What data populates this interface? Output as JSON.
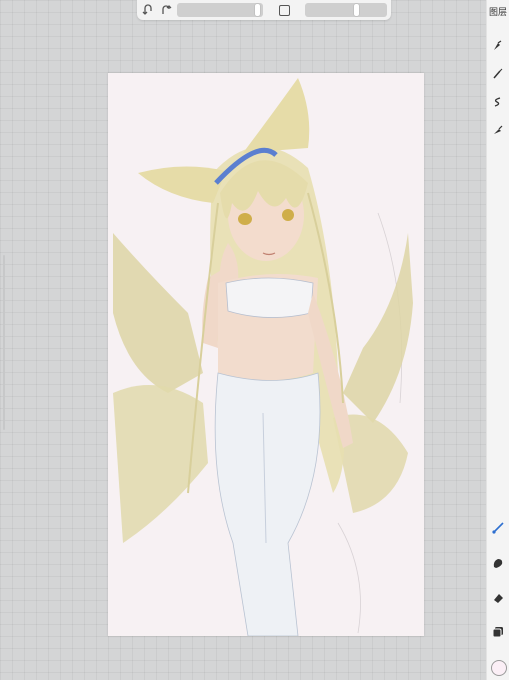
{
  "toolbar": {
    "undo_icon": "undo-arrow-icon",
    "redo_icon": "redo-arrow-icon",
    "brush_size_level": 0.82,
    "opacity_level": 0.6
  },
  "side_panel": {
    "layers_label": "图层",
    "tools": [
      "pen-icon",
      "pencil-icon",
      "smudge-icon",
      "airbrush-icon",
      "brush-icon",
      "smudge-finger-icon",
      "eraser-icon",
      "layers-icon"
    ],
    "color": "#fbeff6"
  },
  "canvas": {
    "background": "#f7f1f3",
    "artwork": "fox-girl-sketch"
  }
}
